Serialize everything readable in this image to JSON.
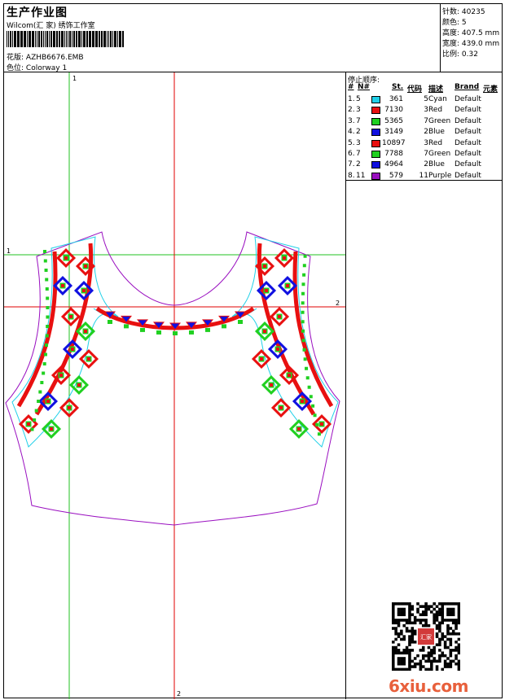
{
  "header": {
    "title": "生产作业图",
    "subtitle": "Wilcom(汇 家) 绣饰工作室",
    "design_label": "花版:",
    "design_value": "AZHB6676.EMB",
    "colorway_label": "色位:",
    "colorway_value": "Colorway 1"
  },
  "stats": [
    {
      "label": "针数:",
      "value": "40235"
    },
    {
      "label": "颜色:",
      "value": "5"
    },
    {
      "label": "高度:",
      "value": "407.5 mm"
    },
    {
      "label": "宽度:",
      "value": "439.0 mm"
    },
    {
      "label": "比例:",
      "value": "0.32"
    }
  ],
  "legend": {
    "title": "停止顺序:",
    "headers": [
      "#",
      "N#",
      "St.",
      "代码",
      "描述",
      "Brand",
      "元素"
    ],
    "rows": [
      {
        "idx": "1.",
        "n": "5",
        "color": "#20d0e8",
        "st": "361",
        "code": "5",
        "desc": "Cyan",
        "brand": "Default"
      },
      {
        "idx": "2.",
        "n": "3",
        "color": "#e81010",
        "st": "7130",
        "code": "3",
        "desc": "Red",
        "brand": "Default"
      },
      {
        "idx": "3.",
        "n": "7",
        "color": "#20d020",
        "st": "5365",
        "code": "7",
        "desc": "Green",
        "brand": "Default"
      },
      {
        "idx": "4.",
        "n": "2",
        "color": "#1010e0",
        "st": "3149",
        "code": "2",
        "desc": "Blue",
        "brand": "Default"
      },
      {
        "idx": "5.",
        "n": "3",
        "color": "#e81010",
        "st": "10897",
        "code": "3",
        "desc": "Red",
        "brand": "Default"
      },
      {
        "idx": "6.",
        "n": "7",
        "color": "#20d020",
        "st": "7788",
        "code": "7",
        "desc": "Green",
        "brand": "Default"
      },
      {
        "idx": "7.",
        "n": "2",
        "color": "#1010e0",
        "st": "4964",
        "code": "2",
        "desc": "Blue",
        "brand": "Default"
      },
      {
        "idx": "8.",
        "n": "11",
        "color": "#9a10c0",
        "st": "579",
        "code": "11",
        "desc": "Purple",
        "brand": "Default"
      }
    ]
  },
  "canvas": {
    "guide_v1": "1",
    "guide_h1": "1",
    "guide_h2": "2",
    "guide_v2": "2"
  },
  "watermark": {
    "brand": "6xiu.com",
    "stamp_text": "汇家"
  },
  "colors": {
    "cyan": "#20d0e8",
    "red": "#e81010",
    "green": "#20d020",
    "blue": "#1010e0",
    "purple": "#9a10c0",
    "guide_green": "#20c020",
    "guide_red": "#e00000"
  }
}
